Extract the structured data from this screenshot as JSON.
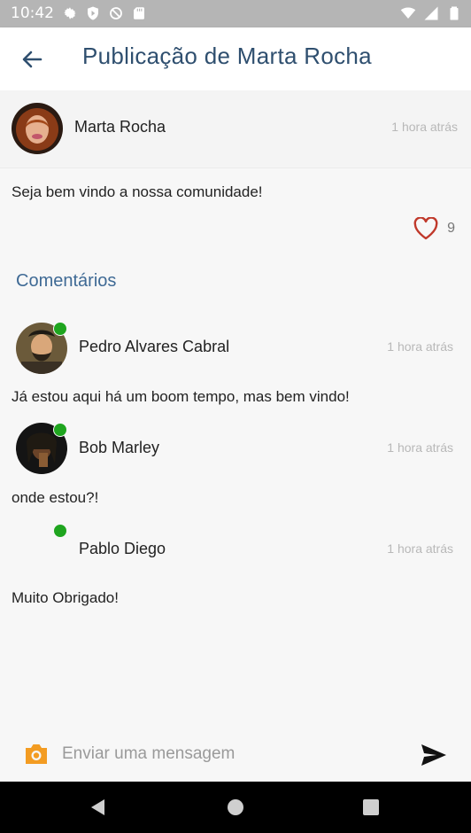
{
  "status_bar": {
    "time": "10:42"
  },
  "app_bar": {
    "title": "Publicação de Marta Rocha"
  },
  "post": {
    "author": "Marta Rocha",
    "time": "1 hora atrás",
    "body": "Seja bem vindo a nossa comunidade!",
    "likes": "9"
  },
  "comments_title": "Comentários",
  "comments": [
    {
      "author": "Pedro Alvares Cabral",
      "time": "1 hora atrás",
      "text": "Já estou aqui há um boom tempo, mas bem vindo!"
    },
    {
      "author": "Bob Marley",
      "time": "1 hora atrás",
      "text": "onde estou?!"
    },
    {
      "author": "Pablo Diego",
      "time": "1 hora atrás",
      "text": "Muito Obrigado!"
    }
  ],
  "composer": {
    "placeholder": "Enviar uma mensagem"
  },
  "colors": {
    "accent": "#2f4f6f",
    "online": "#1fa51f",
    "like": "#c0392b",
    "camera": "#f39c22"
  }
}
